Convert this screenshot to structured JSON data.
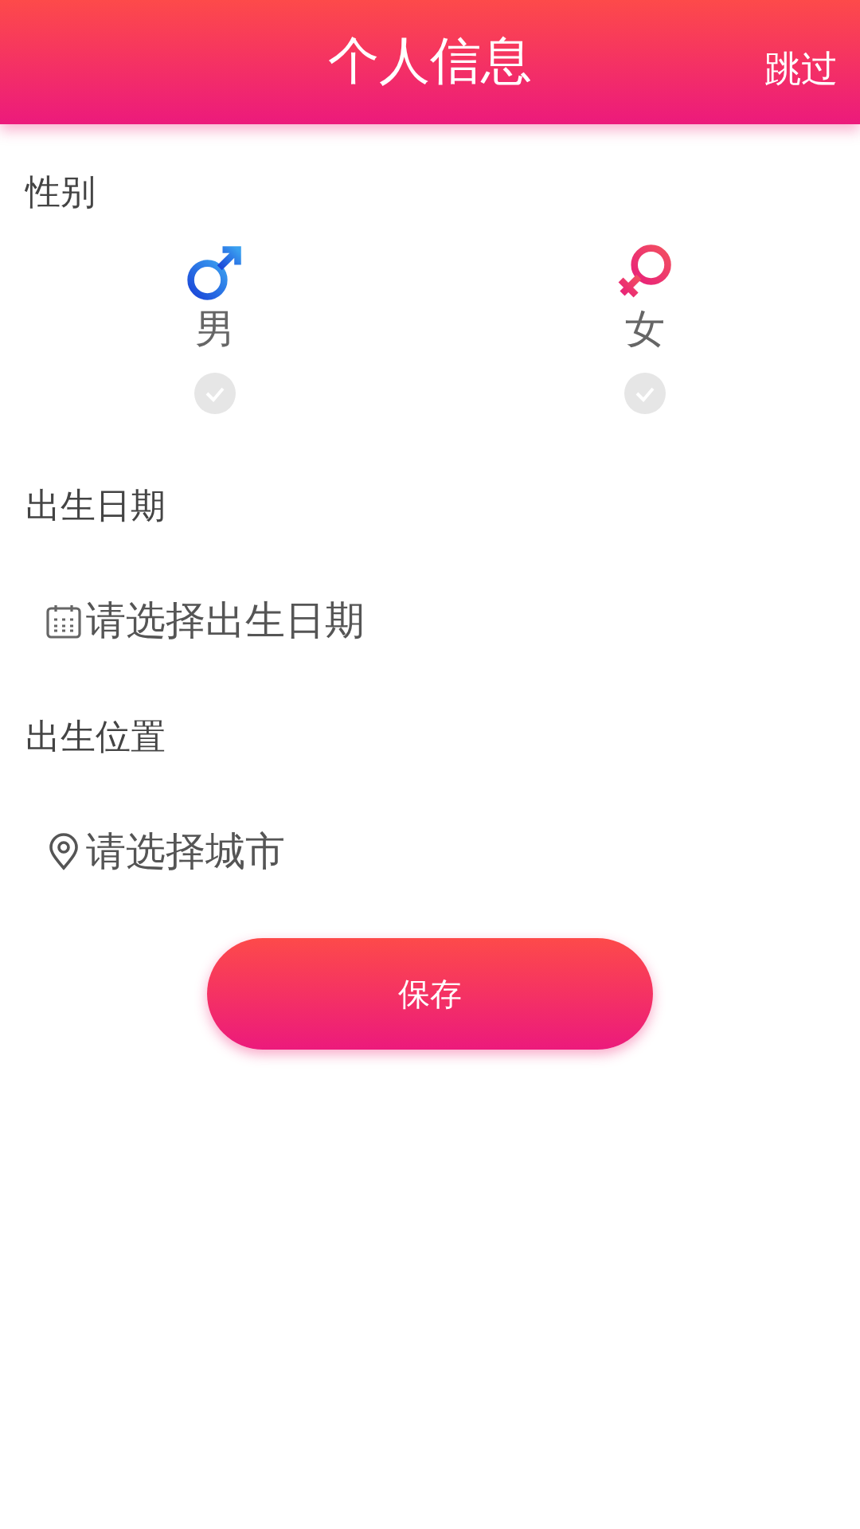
{
  "header": {
    "title": "个人信息",
    "skip": "跳过"
  },
  "gender": {
    "label": "性别",
    "options": [
      {
        "kind": "male",
        "label": "男",
        "selected": false
      },
      {
        "kind": "female",
        "label": "女",
        "selected": false
      }
    ]
  },
  "fields": [
    {
      "label": "出生日期",
      "kind": "date",
      "placeholder": "请选择出生日期"
    },
    {
      "label": "出生位置",
      "kind": "location",
      "placeholder": "请选择城市"
    }
  ],
  "save_button": "保存"
}
